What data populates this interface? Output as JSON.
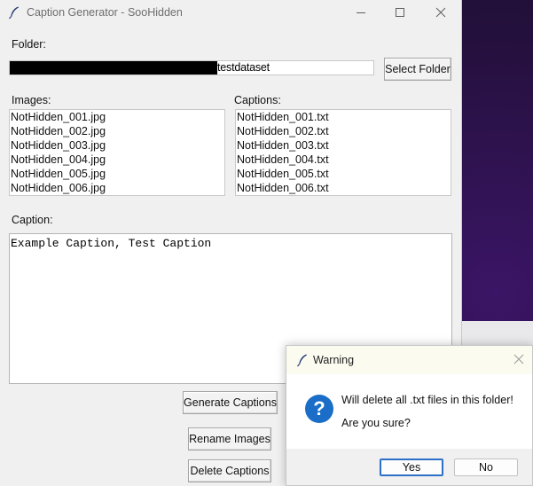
{
  "window": {
    "title": "Caption Generator - SooHidden",
    "icon": "feather-icon"
  },
  "folder": {
    "label": "Folder:",
    "path_visible": "testdataset",
    "select_button": "Select Folder"
  },
  "images": {
    "label": "Images:",
    "items": [
      "NotHidden_001.jpg",
      "NotHidden_002.jpg",
      "NotHidden_003.jpg",
      "NotHidden_004.jpg",
      "NotHidden_005.jpg",
      "NotHidden_006.jpg"
    ]
  },
  "captions": {
    "label": "Captions:",
    "items": [
      "NotHidden_001.txt",
      "NotHidden_002.txt",
      "NotHidden_003.txt",
      "NotHidden_004.txt",
      "NotHidden_005.txt",
      "NotHidden_006.txt"
    ]
  },
  "caption": {
    "label": "Caption:",
    "text": "Example Caption, Test Caption"
  },
  "actions": {
    "generate": "Generate Captions",
    "rename": "Rename Images",
    "delete": "Delete Captions"
  },
  "dialog": {
    "title": "Warning",
    "message": "Will delete all .txt files in this folder!",
    "question": "Are you sure?",
    "yes": "Yes",
    "no": "No",
    "icon": "question-icon",
    "accent_color": "#1a6ec7"
  }
}
